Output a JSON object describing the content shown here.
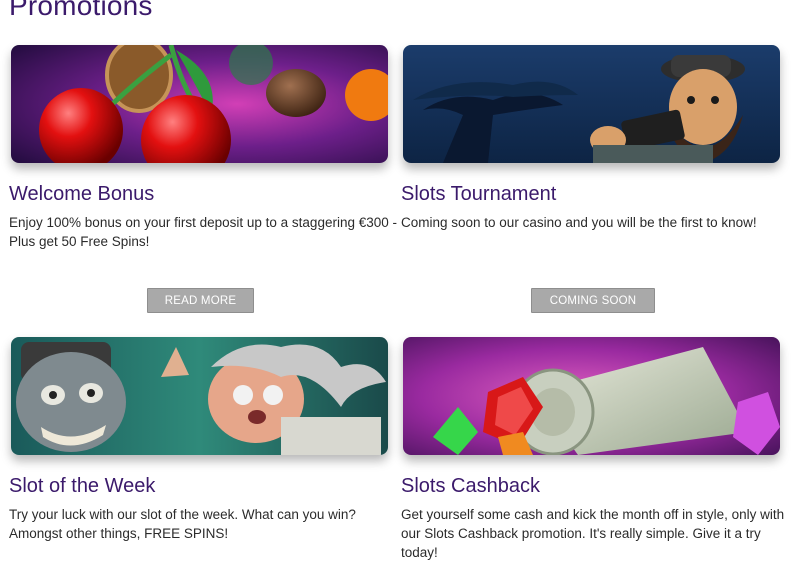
{
  "page": {
    "title": "Promotions"
  },
  "promotions": [
    {
      "title": "Welcome Bonus",
      "text": "Enjoy 100% bonus on your first deposit up to a staggering €300 - Plus get 50 Free Spins!",
      "button": "READ MORE",
      "image": "cherries-and-coins-art"
    },
    {
      "title": "Slots Tournament",
      "text": "Coming soon to our casino and you will be the first to know!",
      "button": "COMING SOON",
      "image": "gnome-with-phone-art"
    },
    {
      "title": "Slot of the Week",
      "text": "Try your luck with our slot of the week. What can you win? Amongst other things, FREE SPINS!",
      "image": "zombie-and-scientist-art"
    },
    {
      "title": "Slots Cashback",
      "text": "Get yourself some cash and kick the month off in style, only with our Slots Cashback promotion. It's really simple. Give it a try today!",
      "image": "cash-roll-and-gems-art"
    }
  ],
  "colors": {
    "heading": "#3b1a6b",
    "button": "#a9a9a9",
    "text": "#2b2b2b"
  }
}
